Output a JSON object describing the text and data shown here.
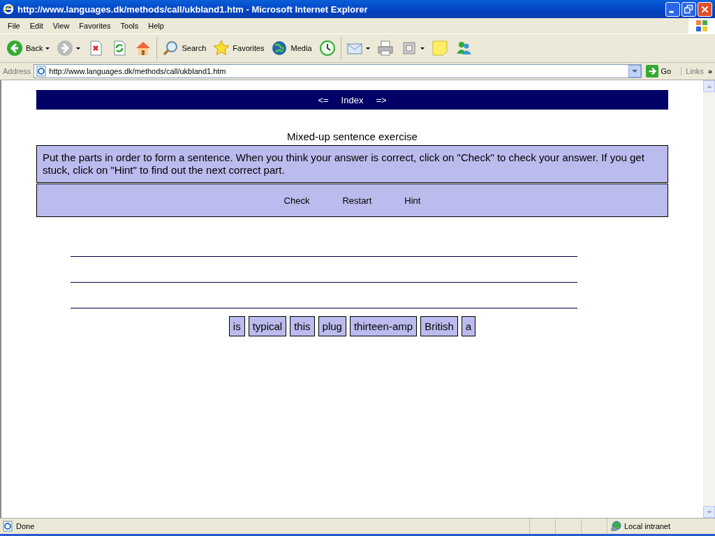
{
  "window": {
    "title": "http://www.languages.dk/methods/call/ukbland1.htm - Microsoft Internet Explorer"
  },
  "menu": [
    "File",
    "Edit",
    "View",
    "Favorites",
    "Tools",
    "Help"
  ],
  "toolbar": [
    {
      "kind": "back",
      "label": "Back",
      "dropdown": true
    },
    {
      "kind": "forward",
      "dropdown": true
    },
    {
      "kind": "stop",
      "dropdown": false
    },
    {
      "kind": "refresh",
      "dropdown": false
    },
    {
      "kind": "home",
      "dropdown": false
    },
    {
      "kind": "search",
      "label": "Search",
      "dropdown": false
    },
    {
      "kind": "favorites",
      "label": "Favorites",
      "dropdown": false
    },
    {
      "kind": "media",
      "label": "Media",
      "dropdown": false
    },
    {
      "kind": "history",
      "dropdown": false
    },
    {
      "kind": "mail",
      "dropdown": true
    },
    {
      "kind": "print",
      "dropdown": false
    },
    {
      "kind": "edit",
      "dropdown": true
    },
    {
      "kind": "note",
      "dropdown": false
    },
    {
      "kind": "messenger",
      "dropdown": false
    }
  ],
  "address": {
    "label": "Address",
    "url": "http://www.languages.dk/methods/call/ukbland1.htm",
    "go": "Go",
    "links": "Links",
    "chevron": "»"
  },
  "page": {
    "nav": [
      "<=",
      "Index",
      "=>"
    ],
    "heading": "Mixed-up sentence exercise",
    "instructions": "Put the parts in order to form a sentence. When you think your answer is correct, click on \"Check\" to check your answer. If you get stuck, click on \"Hint\" to find out the next correct part.",
    "buttons": [
      "Check",
      "Restart",
      "Hint"
    ],
    "parts": [
      "is",
      "typical",
      "this",
      "plug",
      "thirteen-amp",
      "British",
      "a"
    ]
  },
  "status_bar": {
    "text": "Done",
    "zone": "Local intranet"
  }
}
